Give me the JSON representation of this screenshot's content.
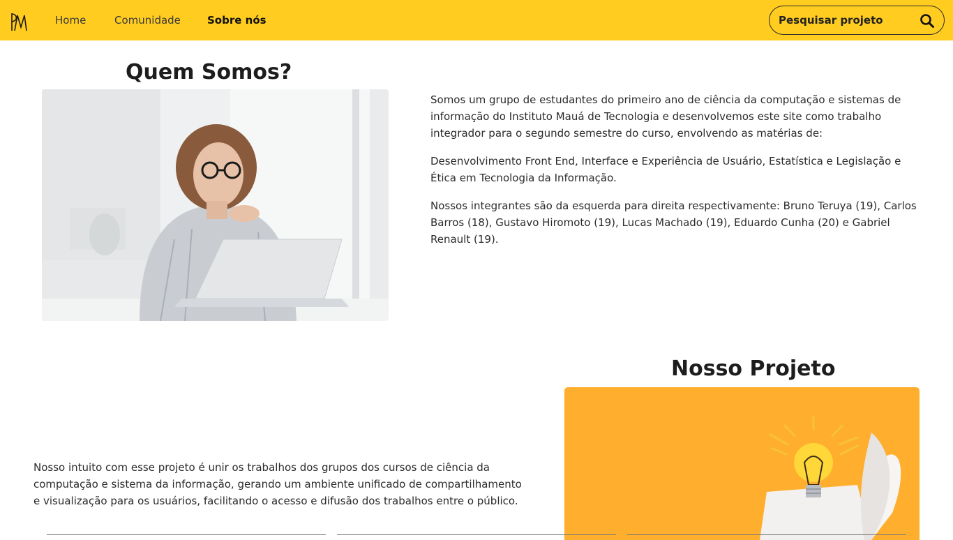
{
  "nav": {
    "links": [
      "Home",
      "Comunidade",
      "Sobre nós"
    ],
    "search_placeholder": "Pesquisar projeto"
  },
  "about": {
    "title": "Quem Somos?",
    "paragraphs": [
      "Somos um grupo de estudantes do primeiro ano de ciência da computação e sistemas de informação do Instituto Mauá de Tecnologia e desenvolvemos este site como trabalho integrador para o segundo semestre do curso, envolvendo as matérias de:",
      "Desenvolvimento Front End, Interface e Experiência de Usuário, Estatística e Legislação e Ética em Tecnologia da Informação.",
      "Nossos integrantes são da esquerda para direita respectivamente: Bruno Teruya (19), Carlos Barros (18), Gustavo Hiromoto (19), Lucas Machado (19), Eduardo Cunha (20) e Gabriel Renault (19)."
    ]
  },
  "project": {
    "title": "Nosso Projeto",
    "text": "Nosso intuito com esse projeto é unir os trabalhos dos grupos dos cursos de ciência da computação e sistema da informação, gerando um ambiente unificado de compartilhamento e visualização para os usuários, facilitando o acesso e difusão dos trabalhos entre o público."
  },
  "colors": {
    "navbar": "#ffcc1f",
    "project_image_bg": "#ffae2e",
    "text": "#2b2b2b"
  },
  "icons": {
    "logo": "pm-monogram-logo",
    "search": "magnifier-icon",
    "photo": "woman-at-laptop-photo",
    "project_image": "lightbulb-paper-photo"
  }
}
